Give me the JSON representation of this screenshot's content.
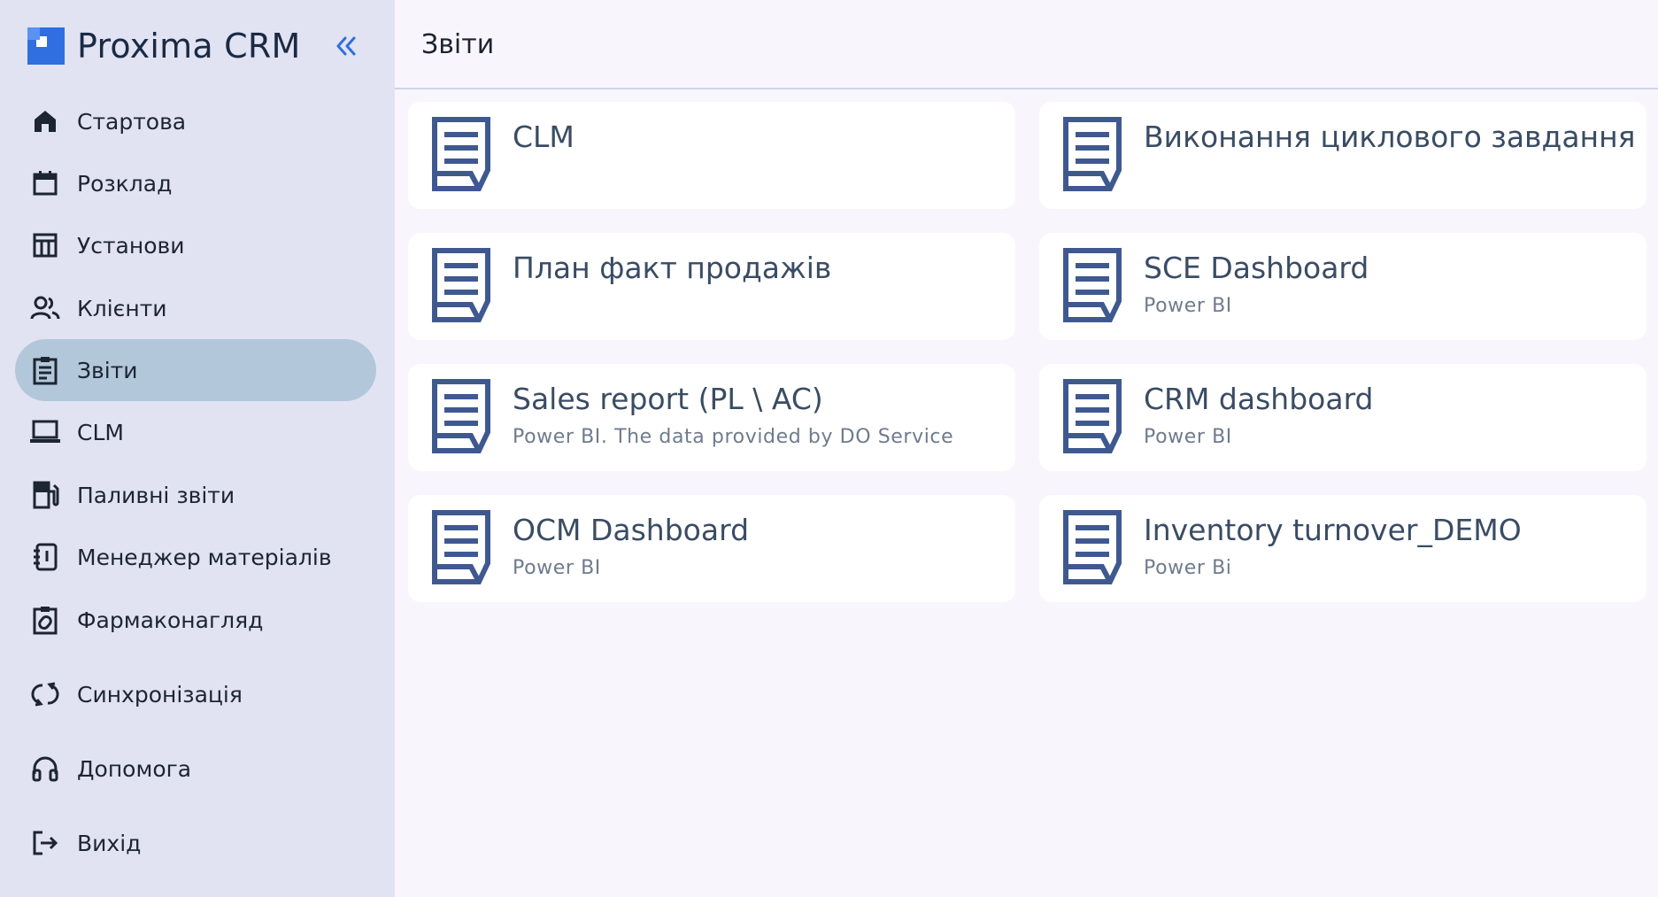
{
  "app": {
    "name": "Proxima CRM",
    "collapse_icon": "double-chevron-left-icon",
    "accent": "#2f6fe0"
  },
  "sidebar": {
    "items": [
      {
        "label": "Стартова",
        "icon": "home-icon",
        "active": false
      },
      {
        "label": "Розклад",
        "icon": "calendar-icon",
        "active": false
      },
      {
        "label": "Установи",
        "icon": "building-icon",
        "active": false
      },
      {
        "label": "Клієнти",
        "icon": "users-icon",
        "active": false
      },
      {
        "label": "Звіти",
        "icon": "clipboard-icon",
        "active": true
      },
      {
        "label": "CLM",
        "icon": "laptop-icon",
        "active": false
      },
      {
        "label": "Паливні звіти",
        "icon": "fuel-icon",
        "active": false
      },
      {
        "label": "Менеджер матеріалів",
        "icon": "notebook-icon",
        "active": false
      },
      {
        "label": "Фармаконагляд",
        "icon": "clipboard-pill-icon",
        "active": false
      },
      {
        "label": "Синхронізація",
        "icon": "sync-icon",
        "active": false
      },
      {
        "label": "Допомога",
        "icon": "headset-icon",
        "active": false
      },
      {
        "label": "Вихід",
        "icon": "logout-icon",
        "active": false
      }
    ]
  },
  "header": {
    "title": "Звіти"
  },
  "reports": [
    {
      "title": "CLM",
      "subtitle": ""
    },
    {
      "title": "Виконання циклового завдання",
      "subtitle": ""
    },
    {
      "title": "План факт продажів",
      "subtitle": ""
    },
    {
      "title": "SCE Dashboard",
      "subtitle": "Power BI"
    },
    {
      "title": "Sales report (PL \\ AC)",
      "subtitle": "Power BI. The data provided by DO Service"
    },
    {
      "title": "CRM dashboard",
      "subtitle": "Power BI"
    },
    {
      "title": "OCM Dashboard",
      "subtitle": "Power BI"
    },
    {
      "title": "Inventory turnover_DEMO",
      "subtitle": "Power Bi"
    }
  ],
  "colors": {
    "sidebar_bg": "#e1e3f3",
    "active_bg": "#b3c7da",
    "card_icon": "#3f5990",
    "page_bg": "#f8f6fc"
  }
}
